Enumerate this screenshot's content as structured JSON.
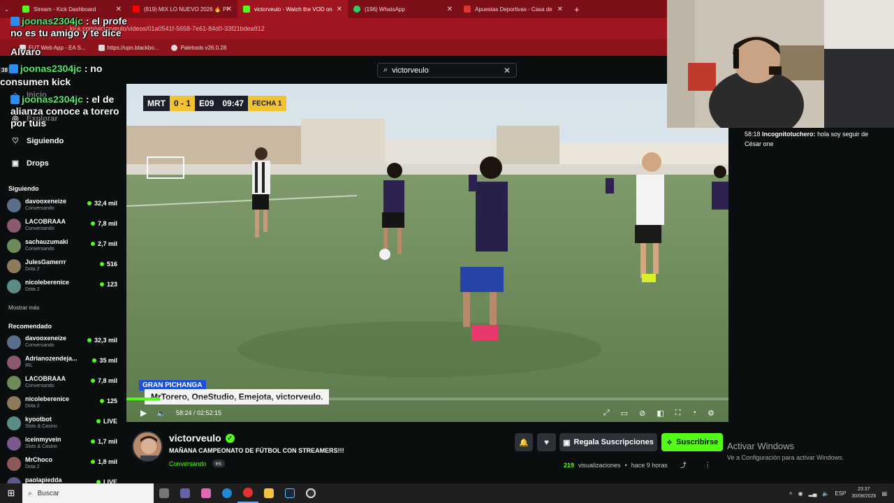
{
  "browser": {
    "tabs": [
      {
        "label": "Stream - Kick Dashboard",
        "color": "#53fc18"
      },
      {
        "label": "(819) MIX LO NUEVO 2026 🔥 PI",
        "color": "#ff0000"
      },
      {
        "label": "victorveulo - Watch the VOD on",
        "color": "#53fc18",
        "active": true
      },
      {
        "label": "(196) WhatsApp",
        "color": "#25d366"
      },
      {
        "label": "Apuestas Deportivas - Casa de",
        "color": "#e0332f"
      }
    ],
    "new_tab": "+",
    "url": "kick.com/victorveulo/videos/01a0541f-5658-7e61-84d0-33f21bdea912",
    "bookmarks": [
      {
        "label": "FUT Web App - EA S..."
      },
      {
        "label": "https://upn.blackbo..."
      },
      {
        "label": "Paletools v26.0.28"
      }
    ]
  },
  "kick": {
    "search_value": "victorveulo",
    "nav": [
      {
        "label": "Inicio",
        "icon": "home-icon"
      },
      {
        "label": "Explorar",
        "icon": "compass-icon"
      },
      {
        "label": "Siguiendo",
        "icon": "heart-icon"
      },
      {
        "label": "Drops",
        "icon": "gift-icon"
      }
    ],
    "following_heading": "Siguiendo",
    "following": [
      {
        "name": "davooxeneize",
        "category": "Conversando",
        "viewers": "32,4 mil"
      },
      {
        "name": "LACOBRAAA",
        "category": "Conversando",
        "viewers": "7,8 mil"
      },
      {
        "name": "sachauzumaki",
        "category": "Conversando",
        "viewers": "2,7 mil"
      },
      {
        "name": "JulesGamerrr",
        "category": "Dota 2",
        "viewers": "516"
      },
      {
        "name": "nicoleberenice",
        "category": "Dota 2",
        "viewers": "123"
      }
    ],
    "show_more": "Mostrar más",
    "recommended_heading": "Recomendado",
    "recommended": [
      {
        "name": "davooxeneize",
        "category": "Conversando",
        "viewers": "32,3 mil"
      },
      {
        "name": "Adrianozendeja...",
        "category": "IRL",
        "viewers": "35 mil"
      },
      {
        "name": "LACOBRAAA",
        "category": "Conversando",
        "viewers": "7,8 mil"
      },
      {
        "name": "nicoleberenice",
        "category": "Dota 2",
        "viewers": "125"
      },
      {
        "name": "kyootbot",
        "category": "Slots & Casino",
        "viewers": "LIVE"
      },
      {
        "name": "iceinmyvein",
        "category": "Slots & Casino",
        "viewers": "1,7 mil"
      },
      {
        "name": "MrChoco",
        "category": "Dota 2",
        "viewers": "1,8 mil"
      },
      {
        "name": "paolapiedda",
        "category": "",
        "viewers": "LIVE"
      }
    ]
  },
  "video": {
    "scoreboard": {
      "team1": "MRT",
      "score": "0 - 1",
      "team2": "E09",
      "time": "09:47",
      "round": "FECHA 1"
    },
    "lower_tag": "GRAN PICHANGA",
    "lower_names": "MrTorero, OneStudio, Emejota, victorveulo.",
    "progress": 0.056,
    "time_current": "58:24",
    "time_total": "02:52:15"
  },
  "stream": {
    "name": "victorveulo",
    "title": "MAÑANA CAMPEONATO DE FÚTBOL CON STREAMERS!!!",
    "category": "Conversando",
    "language": "es",
    "gift_label": "Regala Suscripciones",
    "subscribe_label": "Suscribirse",
    "views": "219",
    "views_label": "visualizaciones",
    "age": "hace 9 horas"
  },
  "chat": [
    {
      "time": "58:18",
      "user": "Incognitotuchero",
      "text": "hola soy seguir de César one"
    }
  ],
  "overlay": [
    {
      "user": "joonas2304jc",
      "text": "el profe no es tu amigo y te dice"
    },
    {
      "plain": "Alvaro"
    },
    {
      "user": "joonas2304jc",
      "text": "no consumen kick"
    },
    {
      "user": "joonas2304jc",
      "text": "el de alianza conoce a torero por tuis"
    }
  ],
  "overlay_prefix": "38",
  "activation": {
    "title": "Activar Windows",
    "subtitle": "Ve a Configuración para activar Windows."
  },
  "taskbar": {
    "search": "Buscar",
    "lang": "ESP",
    "time": "23:37",
    "date": "30/08/2026"
  }
}
